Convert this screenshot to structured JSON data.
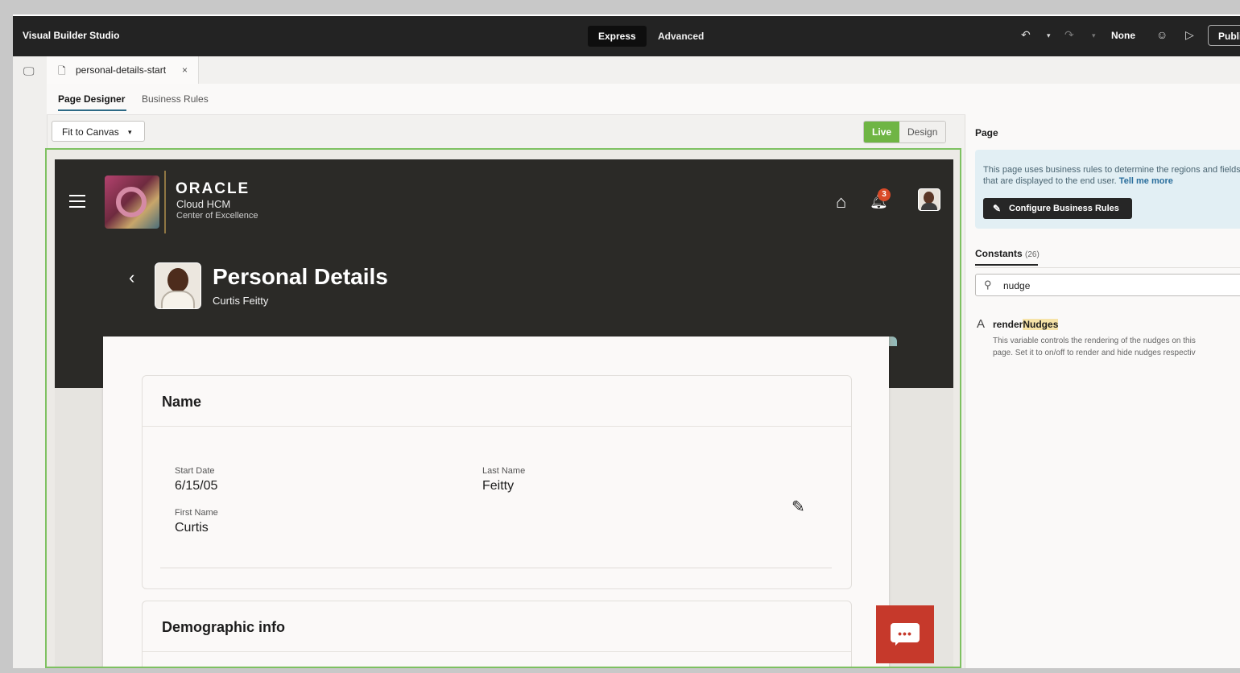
{
  "topbar": {
    "app_title": "Visual Builder Studio",
    "mode_express": "Express",
    "mode_advanced": "Advanced",
    "undo_icon": "undo-icon",
    "redo_icon": "redo-icon",
    "language": "None",
    "emoji_icon": "smiley-icon",
    "preview_icon": "play-icon",
    "publish_label": "Publi"
  },
  "file_tab": {
    "name": "personal-details-start",
    "close": "×"
  },
  "sub_tabs": [
    "Page Designer",
    "Business Rules"
  ],
  "toolbar": {
    "fit_label": "Fit to Canvas",
    "live_label": "Live",
    "design_label": "Design"
  },
  "hcm": {
    "oracle": "ORACLE",
    "product": "Cloud HCM",
    "org": "Center of Excellence",
    "notification_count": "3",
    "page_title": "Personal Details",
    "person_name": "Curtis Feitty",
    "name_section": {
      "title": "Name",
      "fields": [
        {
          "label": "Start Date",
          "value": "6/15/05"
        },
        {
          "label": "Last Name",
          "value": "Feitty"
        },
        {
          "label": "First Name",
          "value": "Curtis"
        }
      ]
    },
    "demo_section": {
      "title": "Demographic info"
    }
  },
  "right_panel": {
    "title": "Page",
    "info_text": "This page uses business rules to determine the regions and fields that are displayed to the end user.",
    "info_link": "Tell me more",
    "configure_label": "Configure Business Rules",
    "constants_label": "Constants",
    "constants_count": "(26)",
    "search_value": "nudge",
    "variable": {
      "name_prefix": "render",
      "name_match": "Nudges",
      "description_line1": "This variable controls the rendering of the nudges on this",
      "description_line2": "page. Set it to on/off to render and hide nudges respectiv"
    }
  },
  "colors": {
    "live_green": "#6fb544",
    "canvas_border": "#7ec161",
    "chat_red": "#c6392b",
    "topbar": "#232323"
  }
}
